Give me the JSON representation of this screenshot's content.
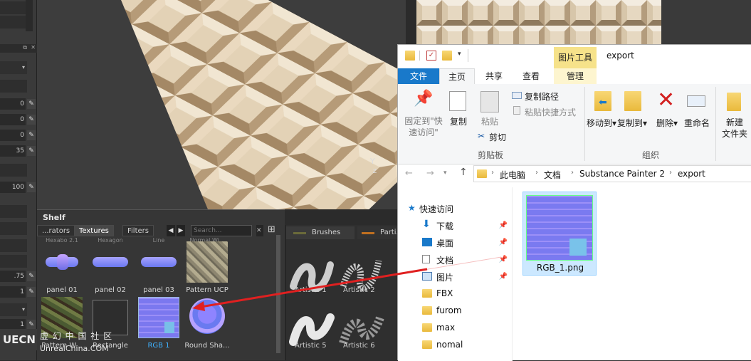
{
  "left_panel": {
    "fields": [
      "0",
      "0",
      "0",
      "35",
      "100",
      ".75",
      "1",
      "1"
    ]
  },
  "shelf": {
    "title": "Shelf",
    "tabs": [
      "...rators",
      "Textures",
      "Filters"
    ],
    "search_placeholder": "Search...",
    "items_row1": [
      "panel 01",
      "panel 02",
      "panel 03",
      "Pattern UCP"
    ],
    "items_row2": [
      "Pattern W...",
      "Rectangle",
      "RGB 1",
      "Round Sha..."
    ],
    "header_cut": [
      "Hexabo 2.1",
      "Hexagon",
      "Line",
      "Normal Wi..."
    ]
  },
  "brushes": {
    "tabs": [
      "Brushes",
      "Parti..."
    ],
    "items": [
      "Artistic 1",
      "Artistic 2",
      "Artistic 5",
      "Artistic 6"
    ]
  },
  "watermark": {
    "line1": "虚 幻 中 国 社 区",
    "line2": "UnrealChina.COM"
  },
  "explorer": {
    "window_title": "export",
    "contextual_tab": "图片工具",
    "tabs": [
      "文件",
      "主页",
      "共享",
      "查看",
      "管理"
    ],
    "ribbon": {
      "pin": "固定到\"快速访问\"",
      "copy": "复制",
      "paste": "粘贴",
      "copy_path": "复制路径",
      "paste_shortcut": "粘贴快捷方式",
      "cut": "剪切",
      "clipboard_group": "剪贴板",
      "move_to": "移动到",
      "copy_to": "复制到",
      "delete": "删除",
      "rename": "重命名",
      "new_folder": "新建\n文件夹",
      "organize_group": "组织"
    },
    "breadcrumb": [
      "此电脑",
      "文档",
      "Substance Painter 2",
      "export"
    ],
    "nav": [
      {
        "label": "快速访问",
        "pinned": false
      },
      {
        "label": "下载",
        "pinned": true
      },
      {
        "label": "桌面",
        "pinned": true
      },
      {
        "label": "文档",
        "pinned": true
      },
      {
        "label": "图片",
        "pinned": true
      },
      {
        "label": "FBX",
        "pinned": false
      },
      {
        "label": "furom",
        "pinned": false
      },
      {
        "label": "max",
        "pinned": false
      },
      {
        "label": "nomal",
        "pinned": false
      }
    ],
    "file": {
      "name": "RGB_1.png"
    }
  },
  "colors": {
    "accent": "#1979ca",
    "arrow": "#e02020",
    "contextual": "#f6e28a"
  }
}
